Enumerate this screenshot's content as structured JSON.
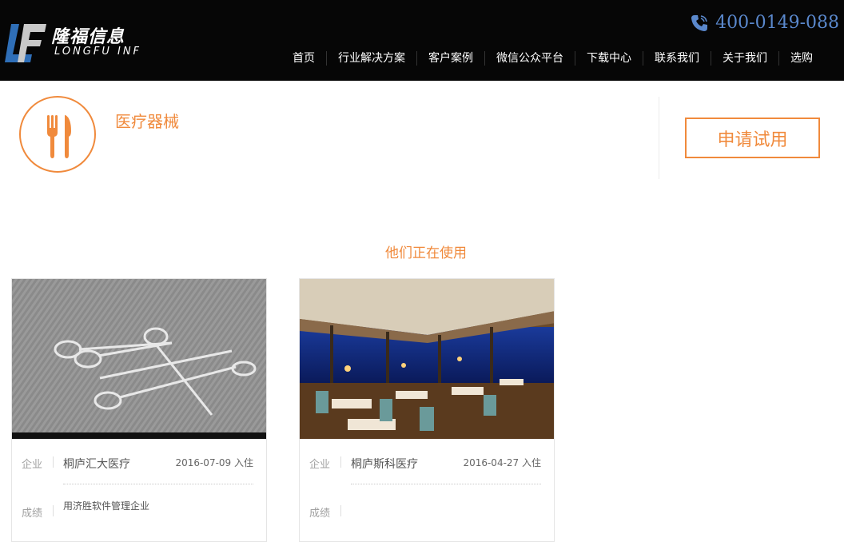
{
  "header": {
    "logo_name": "隆福信息",
    "logo_sub": "LONGFU INF",
    "phone": "400-0149-088",
    "nav": [
      "首页",
      "行业解决方案",
      "客户案例",
      "微信公众平台",
      "下载中心",
      "联系我们",
      "关于我们",
      "选购"
    ]
  },
  "industry": {
    "title": "医疗器械",
    "apply_label": "申请试用",
    "icon": "fork-knife-icon"
  },
  "section_title": "他们正在使用",
  "cards": [
    {
      "label_company": "企业",
      "name": "桐庐汇大医疗",
      "date": "2016-07-09  入住",
      "label_result": "成绩",
      "result": "用济胜软件管理企业",
      "image": "scissors-photo"
    },
    {
      "label_company": "企业",
      "name": "桐庐斯科医疗",
      "date": "2016-04-27  入住",
      "label_result": "成绩",
      "result": "",
      "image": "restaurant-photo"
    }
  ],
  "colors": {
    "accent": "#f08a3c",
    "header_bg": "#060606",
    "phone": "#5a88cc"
  }
}
